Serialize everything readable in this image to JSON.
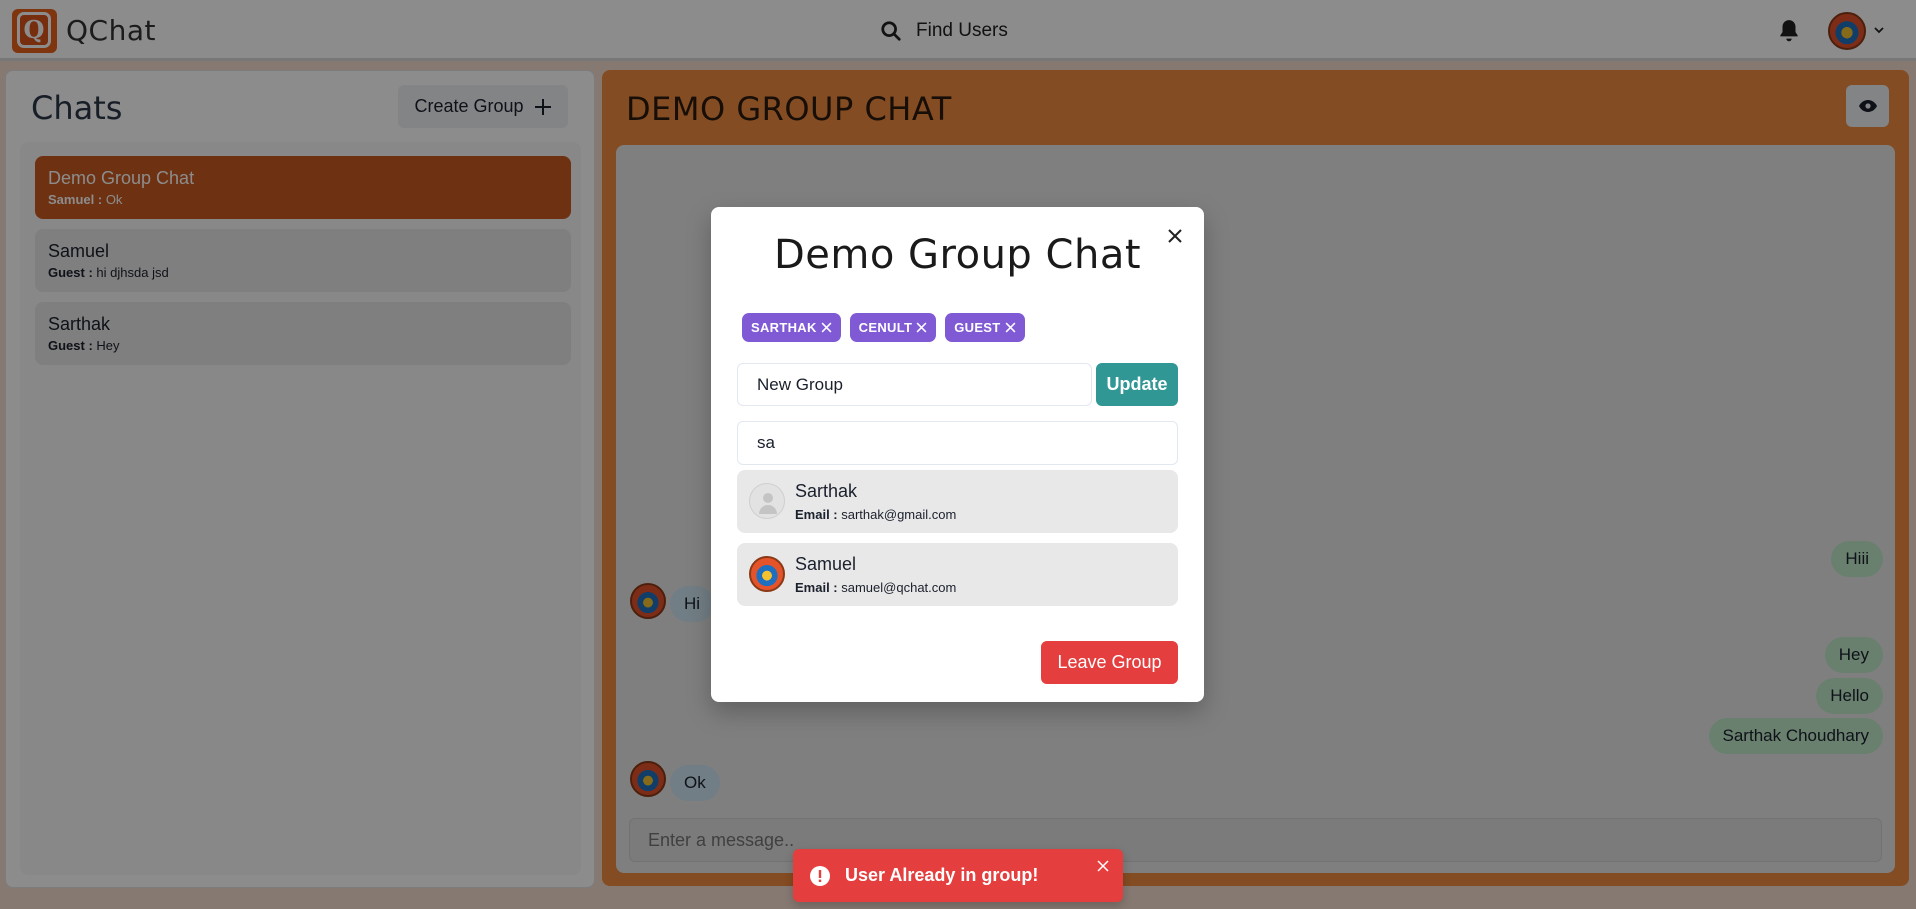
{
  "app": {
    "name": "QChat",
    "logo_letter": "Q",
    "find_users_label": "Find Users"
  },
  "sidebar": {
    "title": "Chats",
    "create_group_label": "Create Group",
    "chats": [
      {
        "name": "Demo Group Chat",
        "sender": "Samuel :",
        "message": "Ok",
        "active": true
      },
      {
        "name": "Samuel",
        "sender": "Guest :",
        "message": "hi djhsda jsd",
        "active": false
      },
      {
        "name": "Sarthak",
        "sender": "Guest :",
        "message": "Hey",
        "active": false
      }
    ]
  },
  "main": {
    "title": "DEMO GROUP CHAT",
    "messages": [
      {
        "text": "Hiii",
        "mine": true
      },
      {
        "text": "Hi",
        "mine": false
      },
      {
        "text": "Hey",
        "mine": true
      },
      {
        "text": "Hello",
        "mine": true
      },
      {
        "text": "Sarthak Choudhary",
        "mine": true
      },
      {
        "text": "Ok",
        "mine": false
      }
    ],
    "input_placeholder": "Enter a message.."
  },
  "modal": {
    "title": "Demo Group Chat",
    "members": [
      "SARTHAK",
      "CENULT",
      "GUEST"
    ],
    "rename_value": "New Group",
    "update_label": "Update",
    "search_value": "sa",
    "results": [
      {
        "name": "Sarthak",
        "email_label": "Email :",
        "email": "sarthak@gmail.com"
      },
      {
        "name": "Samuel",
        "email_label": "Email :",
        "email": "samuel@qchat.com"
      }
    ],
    "leave_label": "Leave Group"
  },
  "toast": {
    "message": "User Already in group!"
  },
  "colors": {
    "accent_orange": "#f08a3f",
    "active_chat": "#c85a1f",
    "badge_purple": "#805ad5",
    "update_teal": "#319795",
    "danger_red": "#e53e3e"
  }
}
